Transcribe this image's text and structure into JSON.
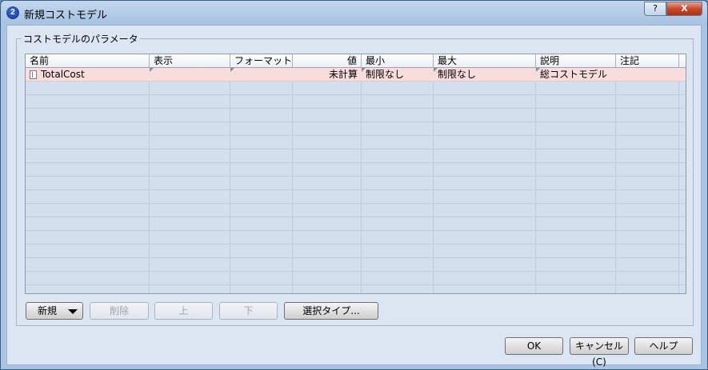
{
  "window": {
    "title": "新規コストモデル",
    "help_glyph": "?",
    "close_glyph": "X",
    "app_icon_glyph": "2"
  },
  "group": {
    "label": "コストモデルのパラメータ"
  },
  "table": {
    "columns": [
      "名前",
      "表示",
      "フォーマット",
      "値",
      "最小",
      "最大",
      "説明",
      "注記"
    ],
    "rows": [
      {
        "name": "TotalCost",
        "display": "",
        "format": "",
        "value": "未計算",
        "min": "制限なし",
        "max": "制限なし",
        "description": "総コストモデル",
        "note": ""
      }
    ]
  },
  "buttons": {
    "new": "新規",
    "delete": "削除",
    "up": "上",
    "down": "下",
    "select_type": "選択タイプ...",
    "ok": "OK",
    "cancel": "キャンセル(C)",
    "help": "ヘルプ"
  }
}
